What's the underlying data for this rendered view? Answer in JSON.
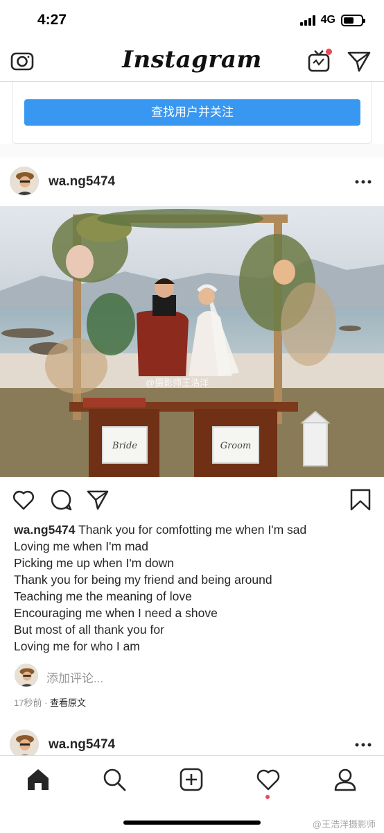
{
  "status_bar": {
    "time": "4:27",
    "network": "4G"
  },
  "top_nav": {
    "brand": "Instagram",
    "icons": [
      "camera-icon",
      "igtv-icon",
      "direct-message-icon"
    ]
  },
  "suggestion_card": {
    "button_label": "查找用户并关注"
  },
  "post": {
    "username": "wa.ng5474",
    "photo_watermark": "@摄影师王浩洋",
    "photo_sign_left": "Bride",
    "photo_sign_right": "Groom",
    "caption_user": "wa.ng5474",
    "caption_lines": [
      "Thank you for comfotting me when I'm sad",
      "Loving me when I'm mad",
      "Picking me up when I'm down",
      "Thank you for being my friend and being around",
      "Teaching me the meaning of love",
      "Encouraging me when I need a shove",
      "But most of all thank you for",
      "Loving me for who I am"
    ],
    "comment_placeholder": "添加评论...",
    "timestamp": "17秒前",
    "separator": " · ",
    "see_original": "查看原文"
  },
  "next_post": {
    "username": "wa.ng5474"
  },
  "bottom_nav": {
    "tabs": [
      "home-icon",
      "search-icon",
      "new-post-icon",
      "activity-icon",
      "profile-icon"
    ]
  },
  "watermark_corner": "@王浩洋摄影师",
  "colors": {
    "button_blue": "#3897f0",
    "notification_red": "#ed4956",
    "text": "#262626",
    "muted": "#8e8e8e"
  }
}
